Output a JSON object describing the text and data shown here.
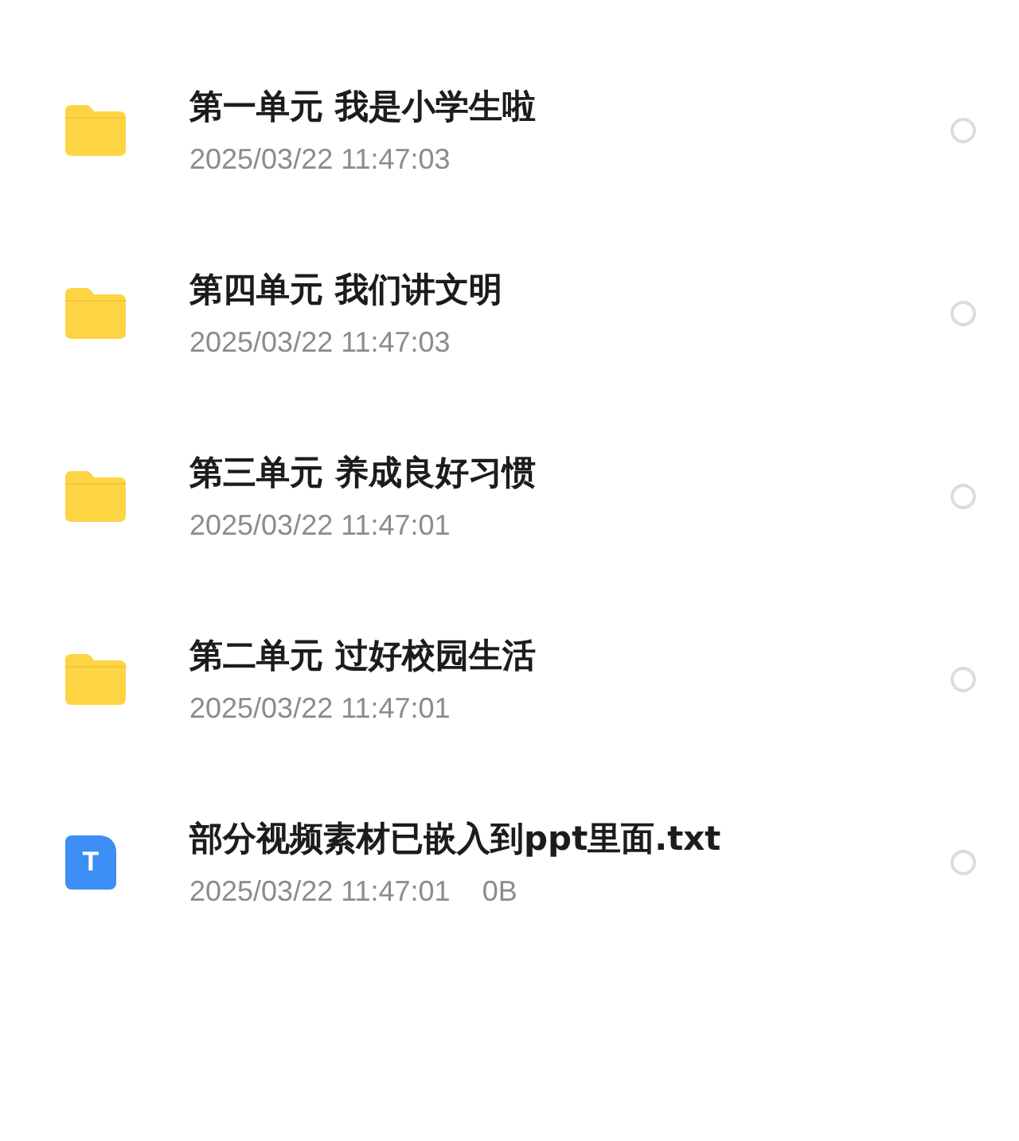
{
  "files": [
    {
      "kind": "folder",
      "name": "第一单元 我是小学生啦",
      "date": "2025/03/22 11:47:03",
      "selected": false
    },
    {
      "kind": "folder",
      "name": "第四单元 我们讲文明",
      "date": "2025/03/22 11:47:03",
      "selected": false
    },
    {
      "kind": "folder",
      "name": "第三单元 养成良好习惯",
      "date": "2025/03/22 11:47:01",
      "selected": false
    },
    {
      "kind": "folder",
      "name": "第二单元 过好校园生活",
      "date": "2025/03/22 11:47:01",
      "selected": false
    },
    {
      "kind": "text",
      "icon_letter": "T",
      "name": "部分视频素材已嵌入到ppt里面.txt",
      "date": "2025/03/22 11:47:01",
      "size": "0B",
      "selected": false
    }
  ]
}
